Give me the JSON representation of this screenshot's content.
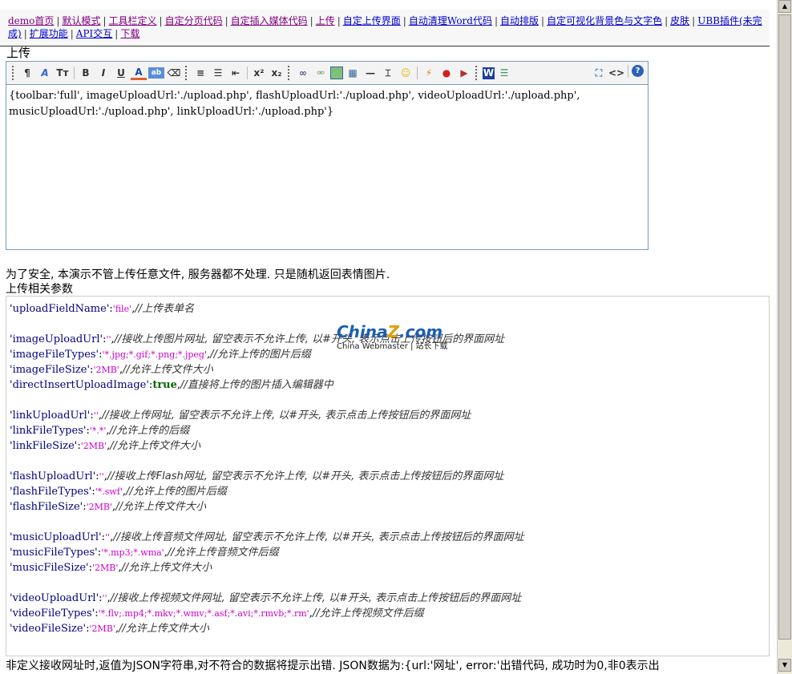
{
  "nav": {
    "links": [
      {
        "label": "demo首页",
        "visited": true
      },
      {
        "label": "默认模式",
        "visited": true
      },
      {
        "label": "工具栏定义",
        "visited": true
      },
      {
        "label": "自定分页代码",
        "visited": true
      },
      {
        "label": "自定插入媒体代码",
        "visited": true
      },
      {
        "label": "上传",
        "visited": true
      },
      {
        "label": "自定上传界面",
        "visited": false
      },
      {
        "label": "自动清理Word代码",
        "visited": false
      },
      {
        "label": "自动排版",
        "visited": false
      },
      {
        "label": "自定可视化背景色与文字色",
        "visited": false
      },
      {
        "label": "皮肤",
        "visited": false
      },
      {
        "label": "UBB插件(未完成)",
        "visited": false
      },
      {
        "label": "扩展功能",
        "visited": false
      },
      {
        "label": "API交互",
        "visited": false
      },
      {
        "label": "下载",
        "visited": true
      }
    ]
  },
  "page_title": "上传",
  "editor": {
    "content": "{toolbar:'full', imageUploadUrl:'./upload.php', flashUploadUrl:'./upload.php', videoUploadUrl:'./upload.php', musicUploadUrl:'./upload.php', linkUploadUrl:'./upload.php'}"
  },
  "note": "为了安全, 本演示不管上传任意文件, 服务器都不处理. 只是随机返回表情图片.",
  "params_title": "上传相关参数",
  "code_groups": [
    [
      {
        "key": "'uploadFieldName'",
        "value": "'file'",
        "comment": "//上传表单名"
      }
    ],
    [
      {
        "key": "'imageUploadUrl'",
        "value": "''",
        "comment": "//接收上传图片网址, 留空表示不允许上传, 以#开头, 表示点击上传按钮后的界面网址"
      },
      {
        "key": "'imageFileTypes'",
        "value": "'*.jpg;*.gif;*.png;*.jpeg'",
        "comment": "//允许上传的图片后缀"
      },
      {
        "key": "'imageFileSize'",
        "value": "'2MB'",
        "comment": "//允许上传文件大小"
      },
      {
        "key": "'directInsertUploadImage'",
        "value": "true",
        "bool": true,
        "comment": "//直接将上传的图片插入编辑器中"
      }
    ],
    [
      {
        "key": "'linkUploadUrl'",
        "value": "''",
        "comment": "//接收上传网址, 留空表示不允许上传, 以#开头, 表示点击上传按钮后的界面网址"
      },
      {
        "key": "'linkFileTypes'",
        "value": "'*.*'",
        "comment": "//允许上传的后缀"
      },
      {
        "key": "'linkFileSize'",
        "value": "'2MB'",
        "comment": "//允许上传文件大小"
      }
    ],
    [
      {
        "key": "'flashUploadUrl'",
        "value": "''",
        "comment": "//接收上传Flash网址, 留空表示不允许上传, 以#开头, 表示点击上传按钮后的界面网址"
      },
      {
        "key": "'flashFileTypes'",
        "value": "'*.swf'",
        "comment": "//允许上传的图片后缀"
      },
      {
        "key": "'flashFileSize'",
        "value": "'2MB'",
        "comment": "//允许上传文件大小"
      }
    ],
    [
      {
        "key": "'musicUploadUrl'",
        "value": "''",
        "comment": "//接收上传音频文件网址, 留空表示不允许上传, 以#开头, 表示点击上传按钮后的界面网址"
      },
      {
        "key": "'musicFileTypes'",
        "value": "'*.mp3;*.wma'",
        "comment": "//允许上传音频文件后缀"
      },
      {
        "key": "'musicFileSize'",
        "value": "'2MB'",
        "comment": "//允许上传文件大小"
      }
    ],
    [
      {
        "key": "'videoUploadUrl'",
        "value": "''",
        "comment": "//接收上传视频文件网址, 留空表示不允许上传, 以#开头, 表示点击上传按钮后的界面网址"
      },
      {
        "key": "'videoFileTypes'",
        "value": "'*.flv;.mp4;*.mkv;*.wmv;*.asf;*.avi;*.rmvb;*.rm'",
        "comment": "//允许上传视频文件后缀"
      },
      {
        "key": "'videoFileSize'",
        "value": "'2MB'",
        "comment": "//允许上传文件大小"
      }
    ]
  ],
  "footer": "非定义接收网址时,返值为JSON字符串,对不符合的数据将提示出错. JSON数据为:{url:'网址', error:'出错代码, 成功时为0,非0表示出",
  "watermark": {
    "logo": "China Z.com",
    "sub": "China Webmaster | 站长下载"
  }
}
